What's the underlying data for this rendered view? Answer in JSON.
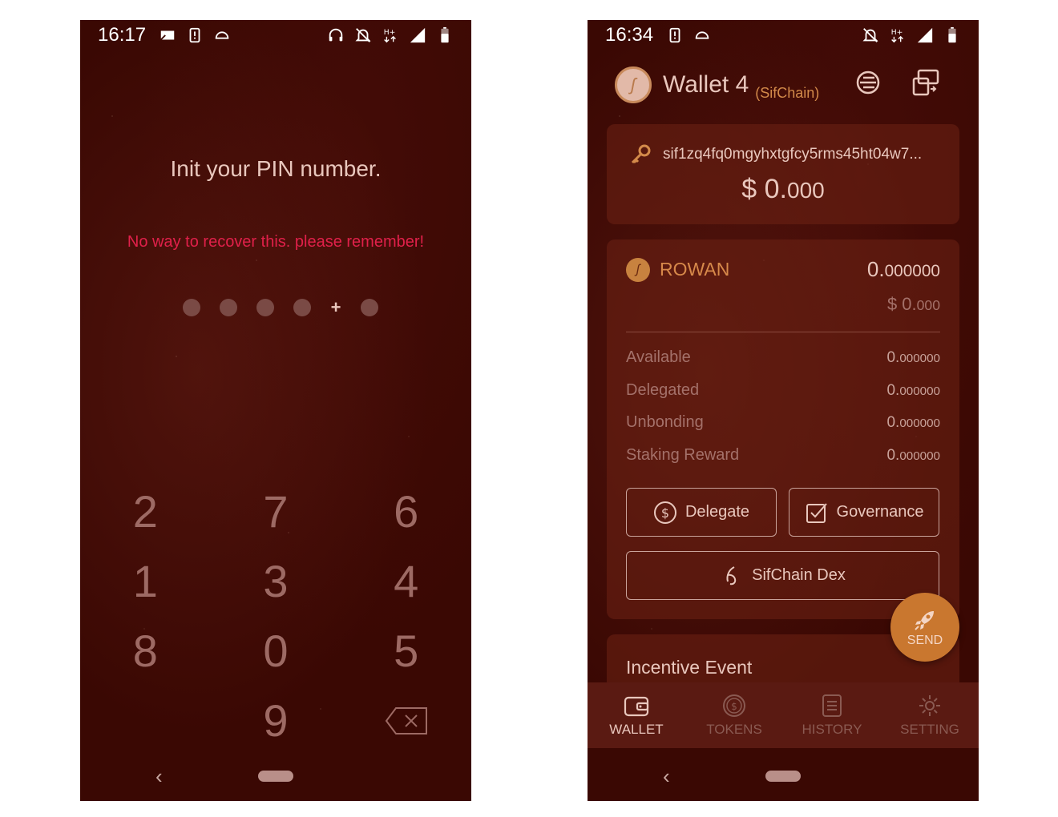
{
  "left_screen": {
    "status": {
      "time": "16:17"
    },
    "title": "Init your PIN number.",
    "warning": "No way to recover this. please remember!",
    "pin_entry": {
      "entered_count": 5,
      "total": 6
    },
    "keypad": {
      "keys": [
        "2",
        "7",
        "6",
        "1",
        "3",
        "4",
        "8",
        "0",
        "5",
        "",
        "9",
        "backspace"
      ]
    }
  },
  "right_screen": {
    "status": {
      "time": "16:34"
    },
    "header": {
      "wallet_name": "Wallet 4",
      "chain": "(SifChain)"
    },
    "address_card": {
      "address": "sif1zq4fq0mgyhxtgfcy5rms45ht04w7...",
      "value_main": "$ 0.",
      "value_decimals": "000"
    },
    "token_card": {
      "symbol": "ROWAN",
      "amount_main": "0.",
      "amount_decimals": "000000",
      "fiat_main": "$ 0.",
      "fiat_decimals": "000",
      "rows": [
        {
          "label": "Available",
          "main": "0.",
          "decimals": "000000"
        },
        {
          "label": "Delegated",
          "main": "0.",
          "decimals": "000000"
        },
        {
          "label": "Unbonding",
          "main": "0.",
          "decimals": "000000"
        },
        {
          "label": "Staking Reward",
          "main": "0.",
          "decimals": "000000"
        }
      ],
      "buttons": {
        "delegate": "Delegate",
        "governance": "Governance",
        "dex": "SifChain Dex"
      }
    },
    "incentive": {
      "title": "Incentive Event"
    },
    "send_button": "SEND",
    "tabs": [
      {
        "label": "WALLET",
        "active": true
      },
      {
        "label": "TOKENS",
        "active": false
      },
      {
        "label": "HISTORY",
        "active": false
      },
      {
        "label": "SETTING",
        "active": false
      }
    ]
  }
}
